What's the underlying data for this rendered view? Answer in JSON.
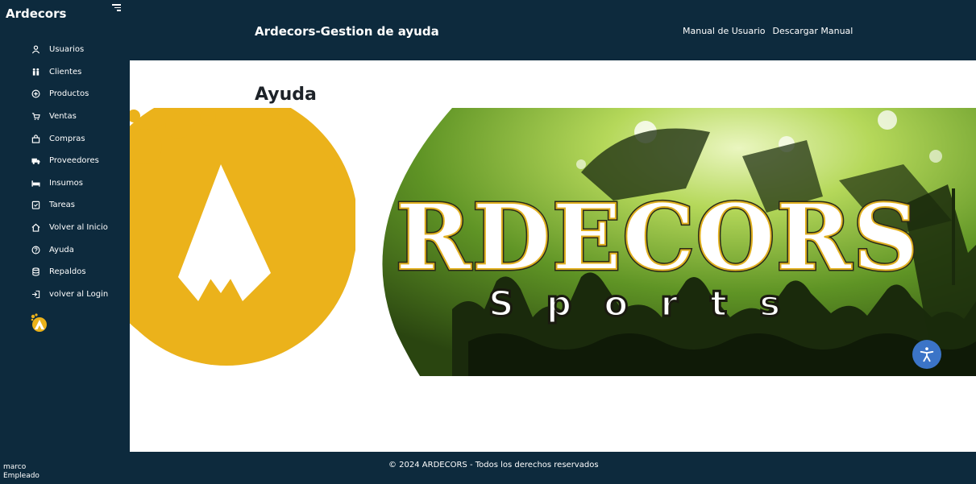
{
  "sidebar": {
    "brand": "Ardecors",
    "items": [
      {
        "label": "Usuarios",
        "icon": "user-icon"
      },
      {
        "label": "Clientes",
        "icon": "people-icon"
      },
      {
        "label": "Productos",
        "icon": "plus-circle-icon"
      },
      {
        "label": "Ventas",
        "icon": "cart-icon"
      },
      {
        "label": "Compras",
        "icon": "bag-icon"
      },
      {
        "label": "Proveedores",
        "icon": "truck-icon"
      },
      {
        "label": "Insumos",
        "icon": "bed-icon"
      },
      {
        "label": "Tareas",
        "icon": "clipboard-icon"
      },
      {
        "label": "Volver al Inicio",
        "icon": "home-icon"
      },
      {
        "label": "Ayuda",
        "icon": "help-icon"
      },
      {
        "label": "Repaldos",
        "icon": "database-icon"
      },
      {
        "label": "volver al Login",
        "icon": "login-icon"
      }
    ],
    "user": {
      "name": "marco",
      "role": "Empleado"
    }
  },
  "header": {
    "title": "Ardecors-Gestion de ayuda",
    "links": [
      "Manual de Usuario",
      "Descargar Manual"
    ]
  },
  "main": {
    "page_title": "Ayuda",
    "banner": {
      "brand_text": "RDECORS",
      "sub_text": "Sports"
    }
  },
  "footer": {
    "text": "© 2024 ARDECORS - Todos los derechos reservados"
  },
  "colors": {
    "sidebar_bg": "#0d2a3d",
    "accent_yellow": "#ebb21b",
    "accessibility_blue": "#3b74c7"
  }
}
